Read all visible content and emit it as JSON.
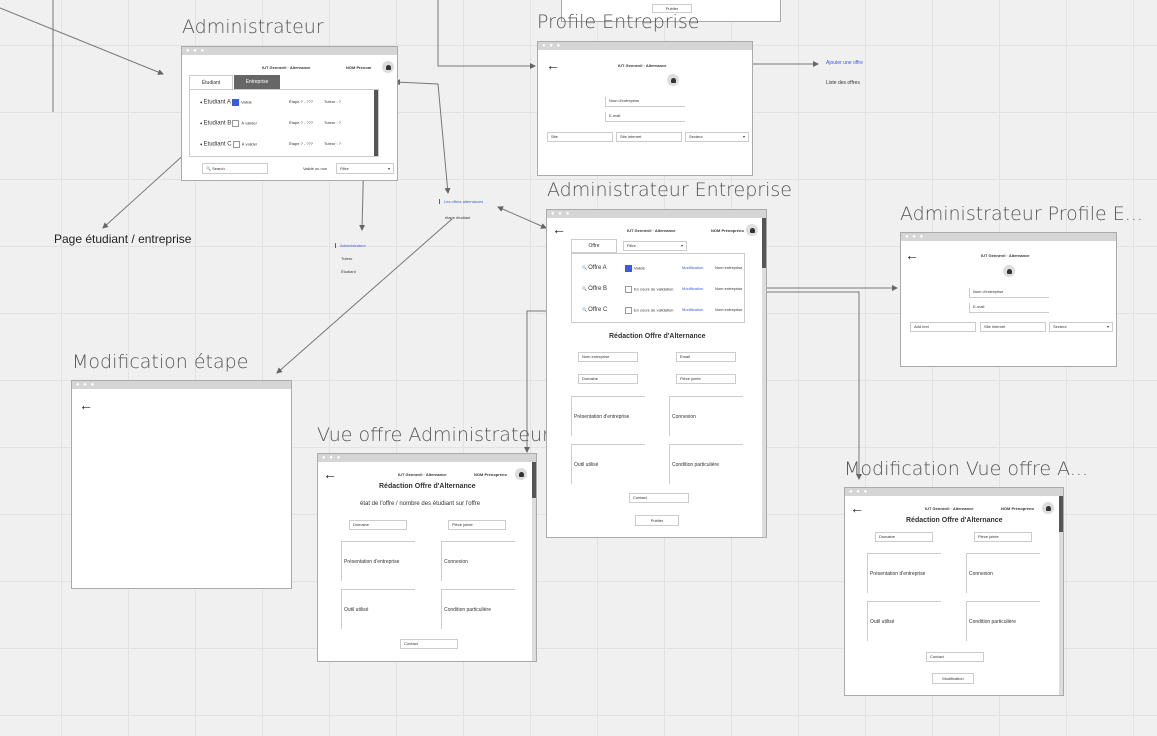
{
  "titles": {
    "admin": "Administrateur",
    "profile_ent": "Profile Entreprise",
    "admin_ent": "Administrateur Entreprise",
    "admin_profile_e": "Administrateur Profile E...",
    "modif_etape": "Modification étape",
    "vue_offre_admin": "Vue offre Administrateur",
    "modif_vue_offre": "Modification Vue offre A..."
  },
  "floating": {
    "page_etudiant": "Page étudiant / entreprise",
    "ajouter_offre": "Ajouter une offre",
    "liste_offres": "Liste des offres",
    "offre_alternances": "Les offres alternances",
    "etape_etudiant": "étape étudiant",
    "menu_admin": "Administrateur",
    "menu_tuteur": "Tuteur",
    "menu_etudiant": "Étudiant",
    "top_publier": "Publier"
  },
  "header": {
    "brand": "IUT Gennevil · Alternance",
    "nom_prenom": "NOM Prénom",
    "nom_prenom2": "NOM Prénopréno"
  },
  "admin": {
    "tab_etudiant": "Étudiant",
    "tab_entreprise": "Entreprise",
    "rows": [
      {
        "name": "Etudiant A",
        "status": "Validé",
        "checked": true,
        "etape": "Étape ? - ???",
        "tuteur": "Tuteur : ?"
      },
      {
        "name": "Etudiant B",
        "status": "À valider",
        "checked": false,
        "etape": "Étape ? - ???",
        "tuteur": "Tuteur : ?"
      },
      {
        "name": "Etudiant C",
        "status": "À valider",
        "checked": false,
        "etape": "Étape ? - ???",
        "tuteur": "Tuteur : ?"
      }
    ],
    "search": "Search",
    "validated": "Validé ou non",
    "filtre": "Filtre"
  },
  "profile": {
    "nom_entreprise": "Nom d'entreprise",
    "email": "E-mail",
    "site": "Site",
    "site_internet": "Site internet",
    "secteur": "Secteur"
  },
  "admin_profile": {
    "add": "Add text",
    "site_internet": "Site internet",
    "secteur": "Secteur"
  },
  "admin_ent": {
    "tab_offre": "Offre",
    "filtre": "Filtre",
    "rows": [
      {
        "name": "Offre A",
        "status": "Validé",
        "checked": true,
        "modif": "Modification",
        "ent": "Nom entreprise"
      },
      {
        "name": "Offre B",
        "status": "En cours de validation",
        "checked": false,
        "modif": "Modification",
        "ent": "Nom entreprise"
      },
      {
        "name": "Offre C",
        "status": "En cours de validation",
        "checked": false,
        "modif": "Modification",
        "ent": "Nom entreprise"
      }
    ],
    "redaction": "Rédaction Offre d'Alternance",
    "f1": "Nom entreprise",
    "f2": "Email",
    "f3": "Domaine",
    "f4": "Pièce jointe",
    "b1": "Présentation d'entreprise",
    "b2": "Connexion",
    "b3": "Outil utilisé",
    "b4": "Condition particulière",
    "contact": "Contact",
    "publier": "Publier"
  },
  "vue_offre": {
    "redaction": "Rédaction Offre d'Alternance",
    "etat": "état de l'offre / nombre des étudiant sur l'offre",
    "f1": "Domaine",
    "f2": "Pièce jointe",
    "b1": "Présentation d'entreprise",
    "b2": "Connexion",
    "b3": "Outil utilisé",
    "b4": "Condition particulière",
    "contact": "Contact"
  },
  "modif_vue": {
    "redaction": "Rédaction Offre d'Alternance",
    "f1": "Domaine",
    "f2": "Pièce jointe",
    "b1": "Présentation d'entreprise",
    "b2": "Connexion",
    "b3": "Outil utilisé",
    "b4": "Condition particulière",
    "contact": "Contact",
    "modification": "Modification"
  }
}
